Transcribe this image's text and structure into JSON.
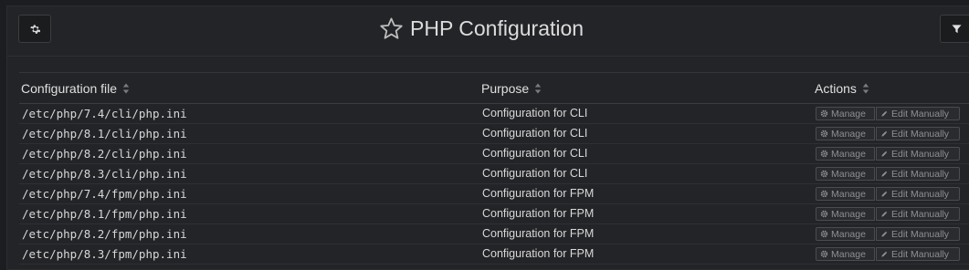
{
  "header": {
    "title": "PHP Configuration",
    "config_icon": "gear-icon",
    "favorite_icon": "star-outline-icon",
    "filter_icon": "filter-icon"
  },
  "table": {
    "columns": [
      {
        "label": "Configuration file",
        "sort_icon": "sort-icon"
      },
      {
        "label": "Purpose",
        "sort_icon": "sort-icon"
      },
      {
        "label": "Actions",
        "sort_icon": "sort-icon"
      }
    ],
    "rows": [
      {
        "file": "/etc/php/7.4/cli/php.ini",
        "purpose": "Configuration for CLI",
        "manage": "Manage",
        "edit": "Edit Manually"
      },
      {
        "file": "/etc/php/8.1/cli/php.ini",
        "purpose": "Configuration for CLI",
        "manage": "Manage",
        "edit": "Edit Manually"
      },
      {
        "file": "/etc/php/8.2/cli/php.ini",
        "purpose": "Configuration for CLI",
        "manage": "Manage",
        "edit": "Edit Manually"
      },
      {
        "file": "/etc/php/8.3/cli/php.ini",
        "purpose": "Configuration for CLI",
        "manage": "Manage",
        "edit": "Edit Manually"
      },
      {
        "file": "/etc/php/7.4/fpm/php.ini",
        "purpose": "Configuration for FPM",
        "manage": "Manage",
        "edit": "Edit Manually"
      },
      {
        "file": "/etc/php/8.1/fpm/php.ini",
        "purpose": "Configuration for FPM",
        "manage": "Manage",
        "edit": "Edit Manually"
      },
      {
        "file": "/etc/php/8.2/fpm/php.ini",
        "purpose": "Configuration for FPM",
        "manage": "Manage",
        "edit": "Edit Manually"
      },
      {
        "file": "/etc/php/8.3/fpm/php.ini",
        "purpose": "Configuration for FPM",
        "manage": "Manage",
        "edit": "Edit Manually"
      }
    ]
  },
  "colors": {
    "background": "#1c1d20",
    "panel": "#232427",
    "text": "#d8d8d8",
    "button_text": "#8d8f93"
  }
}
